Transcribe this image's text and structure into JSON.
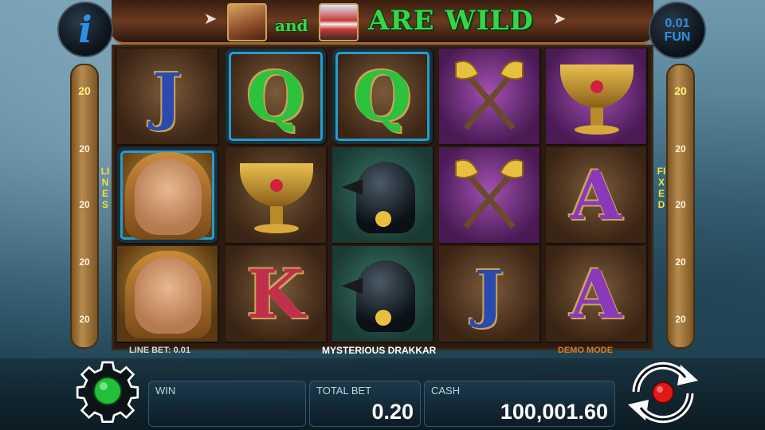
{
  "banner": {
    "connector": "and",
    "wild_text": "ARE WILD"
  },
  "info_button": {
    "glyph": "i"
  },
  "fun_button": {
    "line1": "0.01",
    "line2": "FUN"
  },
  "lines_panel": {
    "values": [
      "20",
      "20",
      "20",
      "20",
      "20"
    ],
    "label": "LINES"
  },
  "fixed_panel": {
    "values": [
      "20",
      "20",
      "20",
      "20",
      "20"
    ],
    "label": "FIXED"
  },
  "reels": {
    "columns": [
      [
        "J",
        "warrior",
        "warrior"
      ],
      [
        "Q",
        "chalice",
        "K"
      ],
      [
        "Q",
        "raven",
        "raven"
      ],
      [
        "axes",
        "axes",
        "J"
      ],
      [
        "chalice",
        "A",
        "A"
      ]
    ],
    "highlighted": [
      [
        0,
        1
      ],
      [
        1,
        0
      ],
      [
        2,
        0
      ]
    ]
  },
  "info_strip": {
    "line_bet": "LINE BET: 0.01",
    "game_name": "MYSTERIOUS DRAKKAR",
    "demo_mode": "DEMO MODE"
  },
  "control_bar": {
    "win_label": "WIN",
    "win_value": "",
    "total_bet_label": "TOTAL BET",
    "total_bet_value": "0.20",
    "cash_label": "CASH",
    "cash_value": "100,001.60"
  },
  "colors": {
    "wild_green": "#39d34a",
    "highlight_blue": "#2a9acb",
    "demo_orange": "#e07a20",
    "status_green": "#22c03a",
    "spin_red": "#e01818"
  },
  "icons": {
    "settings": "gear-icon",
    "spin": "autoplay-refresh-icon"
  }
}
